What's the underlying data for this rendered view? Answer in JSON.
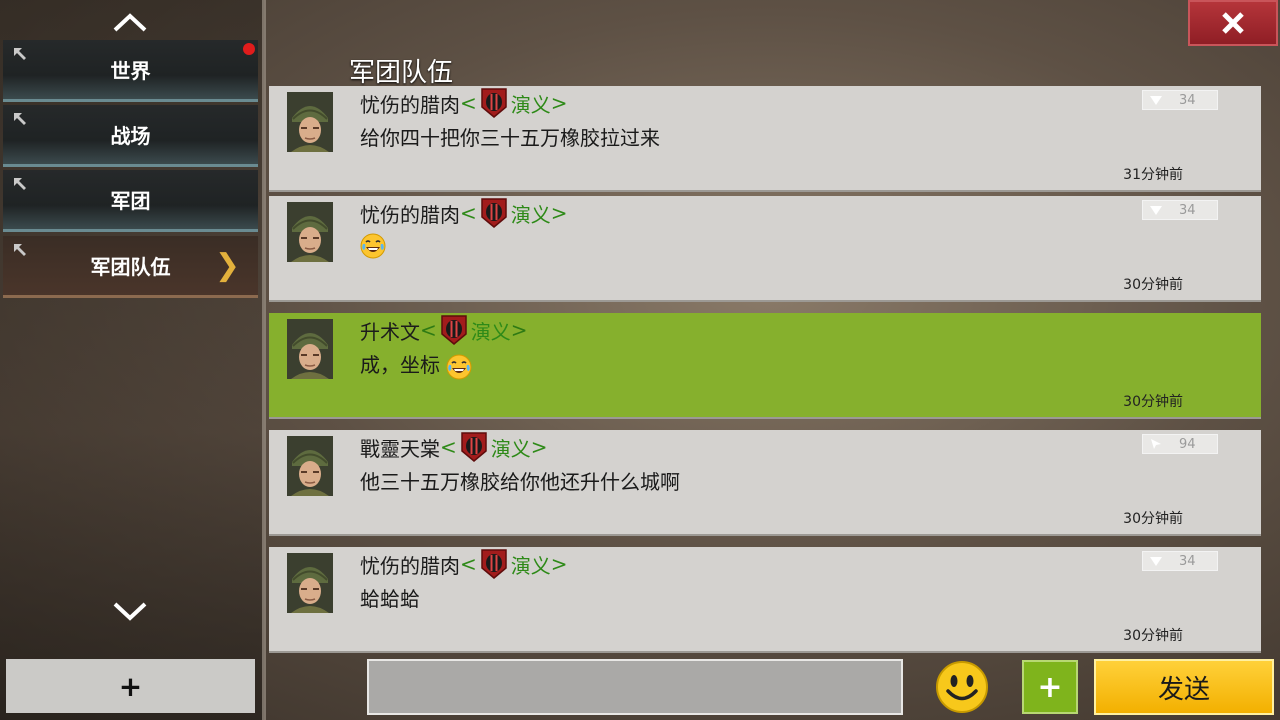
{
  "header": {
    "title": "军团队伍",
    "close_icon": "close-icon"
  },
  "sidebar": {
    "tabs": [
      {
        "label": "世界",
        "has_notification": true
      },
      {
        "label": "战场"
      },
      {
        "label": "军团"
      },
      {
        "label": "军团队伍",
        "active": true
      }
    ],
    "add_label": "+"
  },
  "guild": {
    "name": "演义",
    "open": "<",
    "close": ">"
  },
  "messages": [
    {
      "user": "忧伤的腊肉",
      "text": "给你四十把你三十五万橡胶拉过来",
      "time": "31分钟前",
      "level": "34",
      "level_icon": "down-triangle-icon"
    },
    {
      "user": "忧伤的腊肉",
      "text": "",
      "emoji": "laughing-tears-emoji",
      "time": "30分钟前",
      "level": "34",
      "level_icon": "down-triangle-icon"
    },
    {
      "user": "升术文",
      "text": "成，坐标",
      "emoji": "laughing-tears-emoji",
      "time": "30分钟前",
      "highlight": true
    },
    {
      "user": "戰靈天棠",
      "text": "他三十五万橡胶给你他还升什么城啊",
      "time": "30分钟前",
      "level": "94",
      "level_icon": "arrow-cursor-icon"
    },
    {
      "user": "忧伤的腊肉",
      "text": "蛤蛤蛤",
      "time": "30分钟前",
      "level": "34",
      "level_icon": "down-triangle-icon"
    }
  ],
  "composer": {
    "input_value": "",
    "plus_label": "+",
    "send_label": "发送"
  },
  "colors": {
    "highlight": "#86b02d",
    "send": "#f3b000",
    "close": "#a82a30"
  }
}
